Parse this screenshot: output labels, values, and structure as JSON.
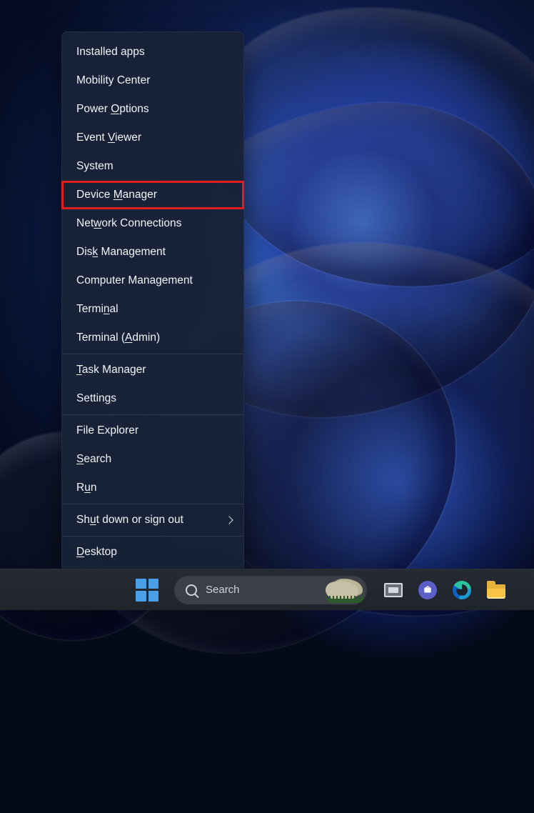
{
  "menu": {
    "groups": [
      [
        {
          "name": "installed-apps-item",
          "pre": "Installed apps",
          "key": "",
          "post": "",
          "submenu": false
        },
        {
          "name": "mobility-center-item",
          "pre": "Mobility Center",
          "key": "",
          "post": "",
          "submenu": false
        },
        {
          "name": "power-options-item",
          "pre": "Power ",
          "key": "O",
          "post": "ptions",
          "submenu": false
        },
        {
          "name": "event-viewer-item",
          "pre": "Event ",
          "key": "V",
          "post": "iewer",
          "submenu": false
        },
        {
          "name": "system-item",
          "pre": "System",
          "key": "",
          "post": "",
          "submenu": false
        },
        {
          "name": "device-manager-item",
          "pre": "Device ",
          "key": "M",
          "post": "anager",
          "submenu": false,
          "highlighted": true
        },
        {
          "name": "network-connections-item",
          "pre": "Net",
          "key": "w",
          "post": "ork Connections",
          "submenu": false
        },
        {
          "name": "disk-management-item",
          "pre": "Dis",
          "key": "k",
          "post": " Management",
          "submenu": false
        },
        {
          "name": "computer-management-item",
          "pre": "Computer Management",
          "key": "",
          "post": "",
          "submenu": false
        },
        {
          "name": "terminal-item",
          "pre": "Termi",
          "key": "n",
          "post": "al",
          "submenu": false
        },
        {
          "name": "terminal-admin-item",
          "pre": "Terminal (",
          "key": "A",
          "post": "dmin)",
          "submenu": false
        }
      ],
      [
        {
          "name": "task-manager-item",
          "pre": "",
          "key": "T",
          "post": "ask Manager",
          "submenu": false
        },
        {
          "name": "settings-item",
          "pre": "Settin",
          "key": "g",
          "post": "s",
          "submenu": false
        }
      ],
      [
        {
          "name": "file-explorer-item",
          "pre": "File Explorer",
          "key": "",
          "post": "",
          "submenu": false
        },
        {
          "name": "search-item",
          "pre": "",
          "key": "S",
          "post": "earch",
          "submenu": false
        },
        {
          "name": "run-item",
          "pre": "R",
          "key": "u",
          "post": "n",
          "submenu": false
        }
      ],
      [
        {
          "name": "shut-down-item",
          "pre": "Sh",
          "key": "u",
          "post": "t down or sign out",
          "submenu": true
        }
      ],
      [
        {
          "name": "desktop-item",
          "pre": "",
          "key": "D",
          "post": "esktop",
          "submenu": false
        }
      ]
    ]
  },
  "taskbar": {
    "search_placeholder": "Search"
  }
}
